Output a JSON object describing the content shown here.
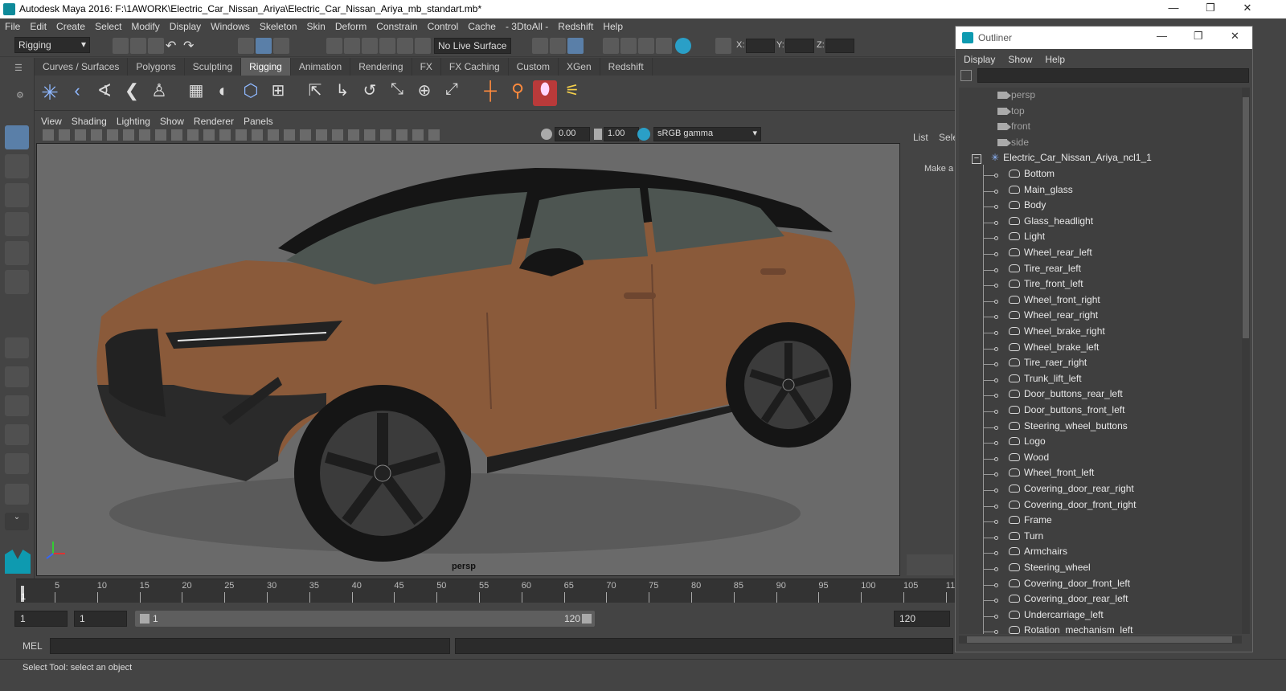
{
  "window": {
    "title": "Autodesk Maya 2016: F:\\1AWORK\\Electric_Car_Nissan_Ariya\\Electric_Car_Nissan_Ariya_mb_standart.mb*",
    "minimize": "—",
    "maximize": "❐",
    "close": "✕"
  },
  "menubar": [
    "File",
    "Edit",
    "Create",
    "Select",
    "Modify",
    "Display",
    "Windows",
    "Skeleton",
    "Skin",
    "Deform",
    "Constrain",
    "Control",
    "Cache",
    "- 3DtoAll -",
    "Redshift",
    "Help"
  ],
  "statusline": {
    "mode": "Rigging",
    "live_surface": "No Live Surface",
    "x_label": "X:",
    "y_label": "Y:",
    "z_label": "Z:"
  },
  "shelf_tabs": [
    {
      "label": "Curves / Surfaces",
      "active": false
    },
    {
      "label": "Polygons",
      "active": false
    },
    {
      "label": "Sculpting",
      "active": false
    },
    {
      "label": "Rigging",
      "active": true
    },
    {
      "label": "Animation",
      "active": false
    },
    {
      "label": "Rendering",
      "active": false
    },
    {
      "label": "FX",
      "active": false
    },
    {
      "label": "FX Caching",
      "active": false
    },
    {
      "label": "Custom",
      "active": false
    },
    {
      "label": "XGen",
      "active": false
    },
    {
      "label": "Redshift",
      "active": false
    }
  ],
  "panel_menu": [
    "View",
    "Shading",
    "Lighting",
    "Show",
    "Renderer",
    "Panels"
  ],
  "panel_toolbar": {
    "exposure": "0.00",
    "gamma": "1.00",
    "color_space": "sRGB gamma"
  },
  "viewport": {
    "camera": "persp",
    "body_color": "#8a5a3a",
    "background": "#6a6a6a"
  },
  "attr_panel": {
    "list_label": "List",
    "sel_label": "Sele",
    "make_label": "Make a"
  },
  "timeslider": {
    "ticks": [
      "5",
      "10",
      "15",
      "20",
      "25",
      "30",
      "35",
      "40",
      "45",
      "50",
      "55",
      "60",
      "65",
      "70",
      "75",
      "80",
      "85",
      "90",
      "95",
      "100",
      "105",
      "11"
    ],
    "current": "1"
  },
  "range": {
    "start": "1",
    "anim_start": "1",
    "slider_start": "1",
    "slider_end": "120",
    "end": "120"
  },
  "mel": {
    "label": "MEL"
  },
  "helpline": "Select Tool: select an object",
  "outliner": {
    "title": "Outliner",
    "menus": [
      "Display",
      "Show",
      "Help"
    ],
    "cameras": [
      "persp",
      "top",
      "front",
      "side"
    ],
    "root": "Electric_Car_Nissan_Ariya_ncl1_1",
    "children": [
      "Bottom",
      "Main_glass",
      "Body",
      "Glass_headlight",
      "Light",
      "Wheel_rear_left",
      "Tire_rear_left",
      "Tire_front_left",
      "Wheel_front_right",
      "Wheel_rear_right",
      "Wheel_brake_right",
      "Wheel_brake_left",
      "Tire_raer_right",
      "Trunk_lift_left",
      "Door_buttons_rear_left",
      "Door_buttons_front_left",
      "Steering_wheel_buttons",
      "Logo",
      "Wood",
      "Wheel_front_left",
      "Covering_door_rear_right",
      "Covering_door_front_right",
      "Frame",
      "Turn",
      "Armchairs",
      "Steering_wheel",
      "Covering_door_front_left",
      "Covering_door_rear_left",
      "Undercarriage_left",
      "Rotation_mechanism_left"
    ]
  }
}
